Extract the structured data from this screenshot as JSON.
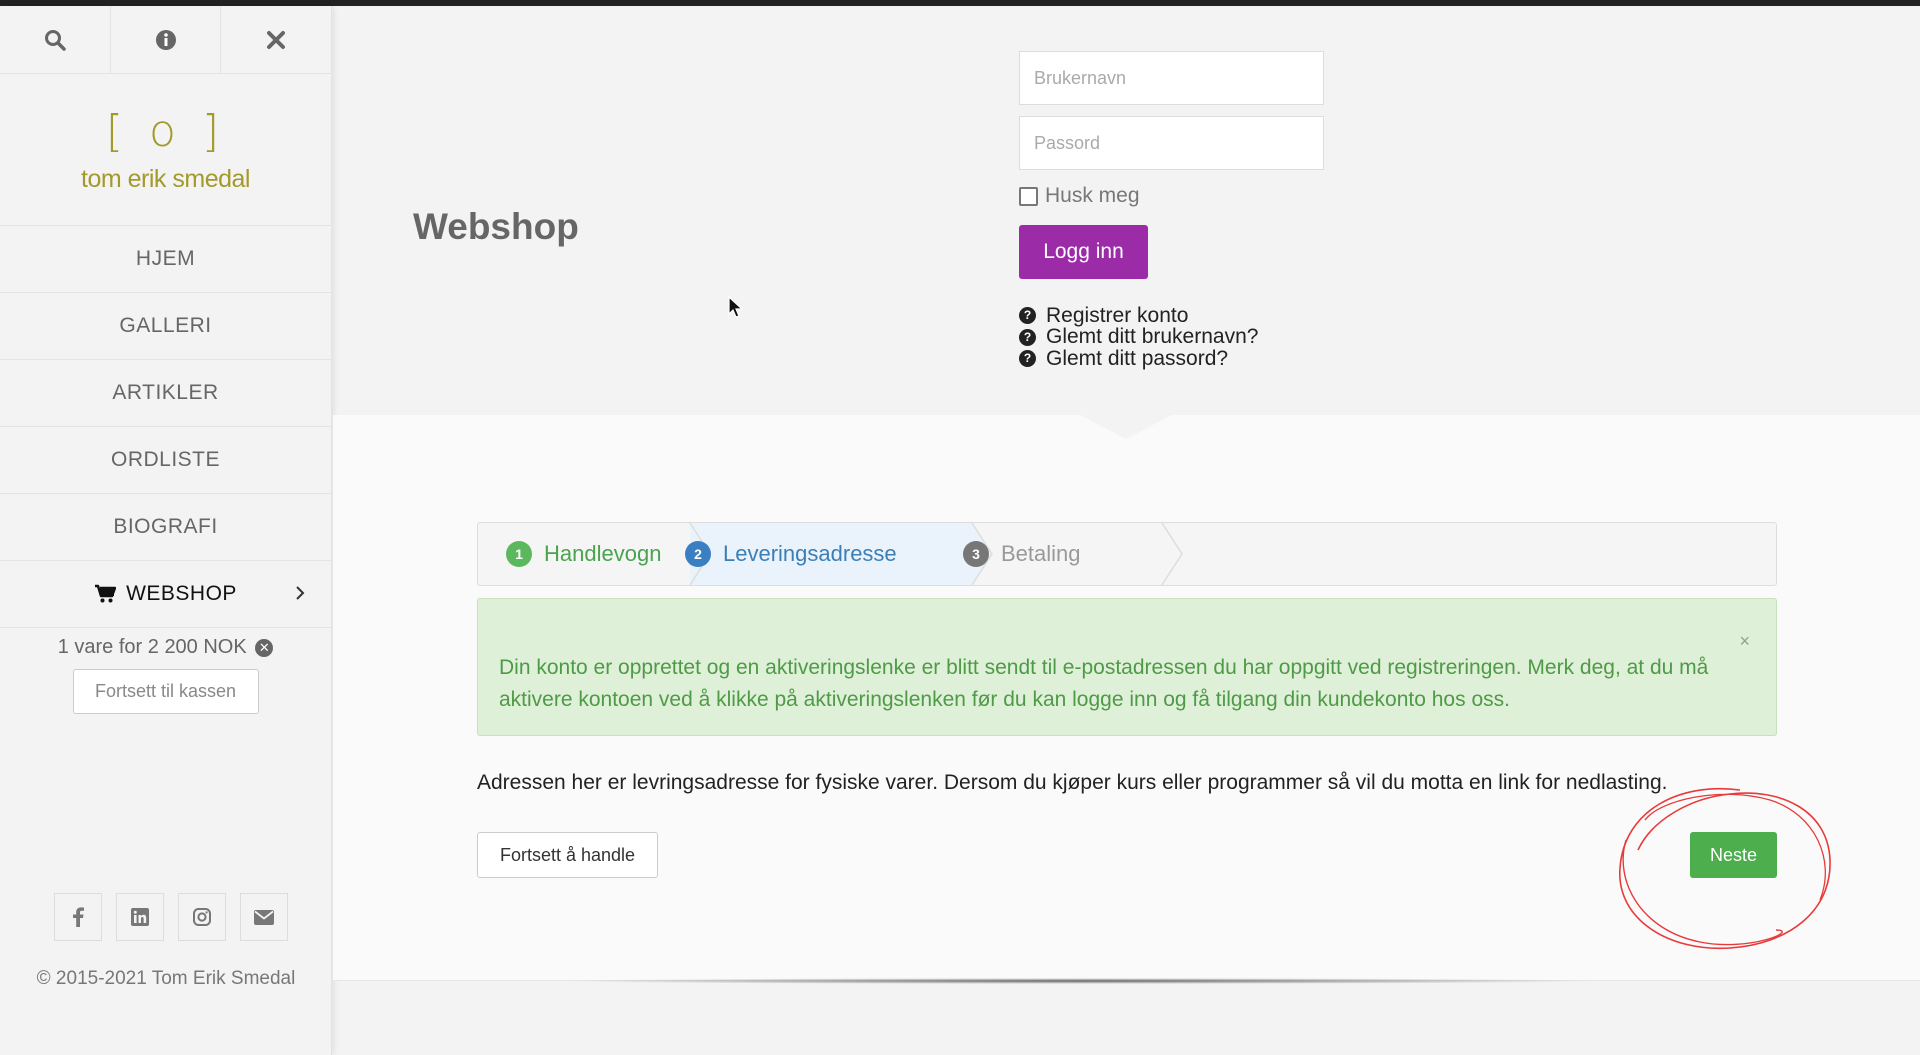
{
  "sidebar": {
    "tools": {
      "search": "search-icon",
      "info": "info-icon",
      "close": "close-icon"
    },
    "logo": {
      "mark": "[ o ]",
      "text": "tom erik smedal"
    },
    "nav": [
      {
        "label": "HJEM"
      },
      {
        "label": "GALLERI"
      },
      {
        "label": "ARTIKLER"
      },
      {
        "label": "ORDLISTE"
      },
      {
        "label": "BIOGRAFI"
      },
      {
        "label": "WEBSHOP"
      }
    ],
    "cart_summary": "1 vare for 2 200 NOK",
    "checkout_label": "Fortsett til kassen",
    "social": [
      "facebook-icon",
      "linkedin-icon",
      "instagram-icon",
      "envelope-icon"
    ],
    "copyright": "© 2015-2021 Tom Erik Smedal"
  },
  "header": {
    "title": "Webshop"
  },
  "login": {
    "username_placeholder": "Brukernavn",
    "password_placeholder": "Passord",
    "remember_label": "Husk meg",
    "login_button": "Logg inn",
    "links": [
      "Registrer konto",
      "Glemt ditt brukernavn?",
      "Glemt ditt passord?"
    ]
  },
  "checkout": {
    "steps": [
      {
        "num": "1",
        "label": "Handlevogn"
      },
      {
        "num": "2",
        "label": "Leveringsadresse"
      },
      {
        "num": "3",
        "label": "Betaling"
      }
    ],
    "alert": "Din konto er opprettet og en aktiveringslenke er blitt sendt til e-postadressen du har oppgitt ved registreringen. Merk deg, at du må aktivere kontoen ved å klikke på aktiveringslenken før du kan logge inn og få tilgang din kundekonto hos oss.",
    "alert_close": "×",
    "info_text": "Adressen her er levringsadresse for fysiske varer. Dersom du kjøper kurs eller programmer så vil du motta en link for nedlasting.",
    "continue_shopping": "Fortsett å handle",
    "next": "Neste"
  },
  "colors": {
    "accent": "#9c2ba8",
    "logo": "#a39a2c",
    "success": "#4cae4c",
    "alert_bg": "#dff0d8",
    "annotation": "#e83a3a"
  }
}
